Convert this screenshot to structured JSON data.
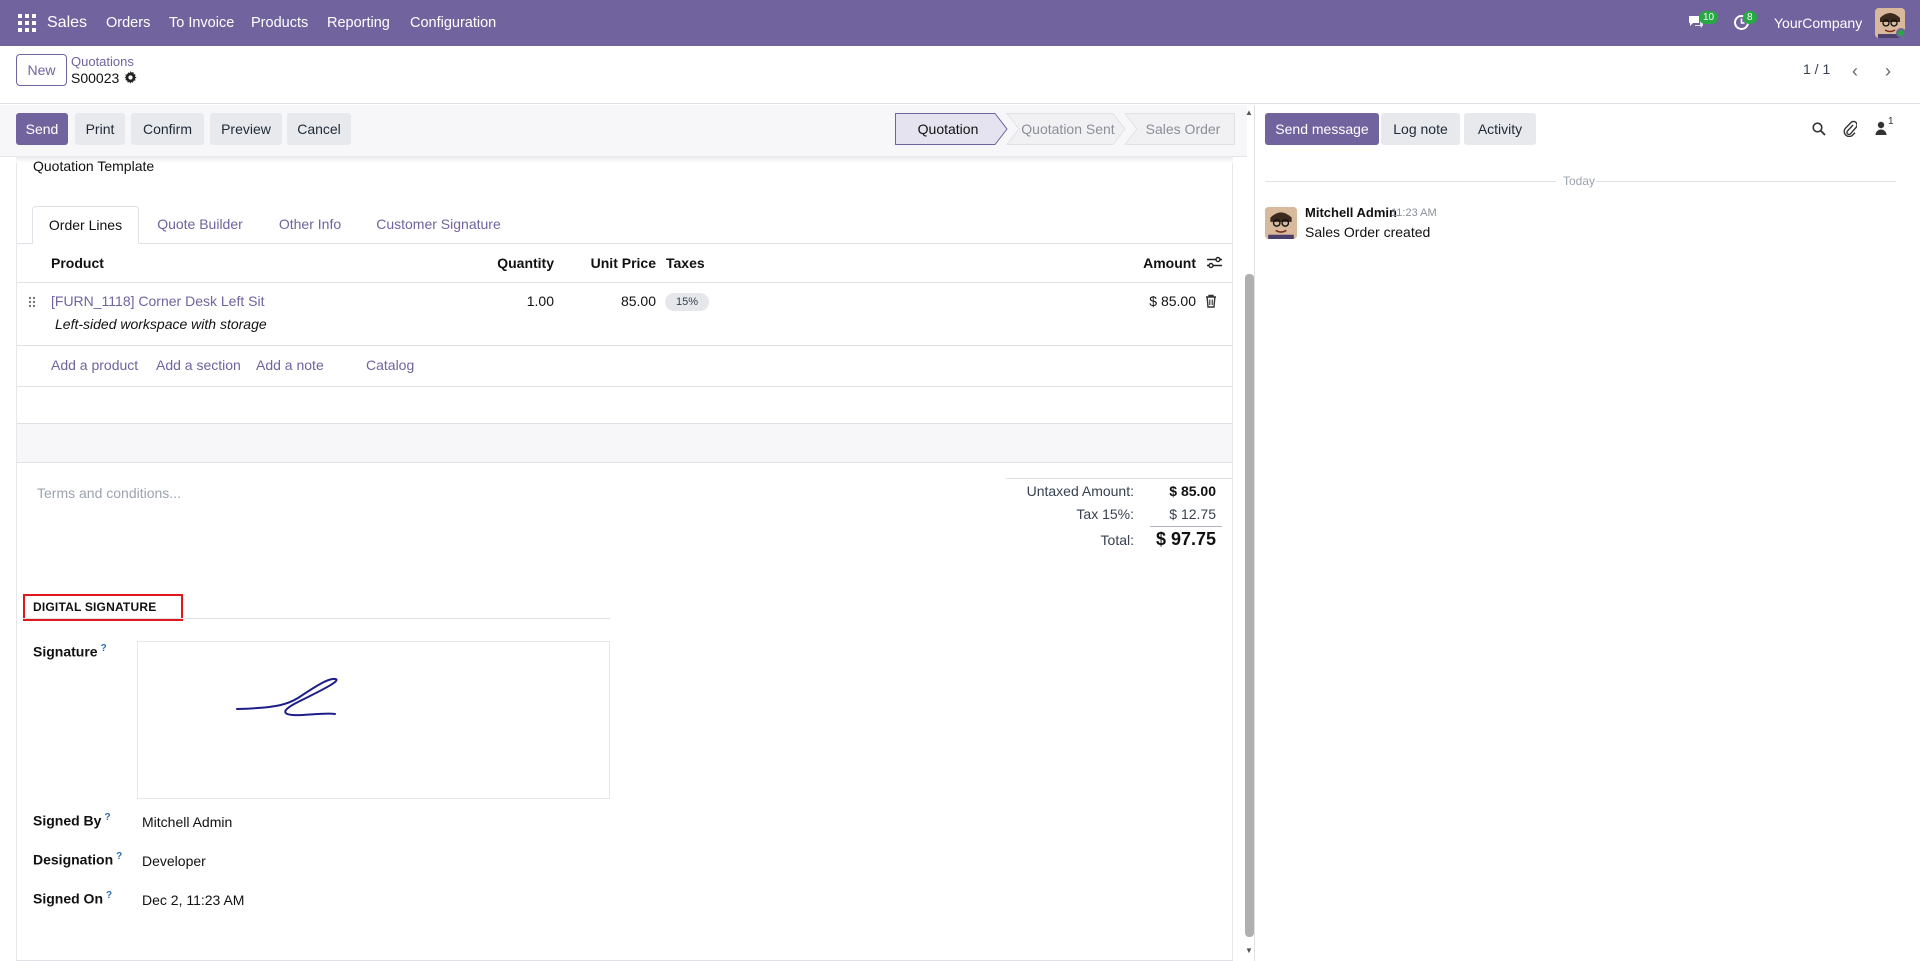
{
  "navbar": {
    "app_name": "Sales",
    "menu": [
      "Orders",
      "To Invoice",
      "Products",
      "Reporting",
      "Configuration"
    ],
    "messages_count": "10",
    "activities_count": "8",
    "company": "YourCompany"
  },
  "control": {
    "new_label": "New",
    "breadcrumb": "Quotations",
    "record_name": "S00023",
    "pager": "1 / 1"
  },
  "actions": {
    "send": "Send",
    "print": "Print",
    "confirm": "Confirm",
    "preview": "Preview",
    "cancel": "Cancel"
  },
  "status": {
    "stages": [
      "Quotation",
      "Quotation Sent",
      "Sales Order"
    ],
    "active": "Quotation"
  },
  "form": {
    "template_label": "Quotation Template",
    "tabs": [
      "Order Lines",
      "Quote Builder",
      "Other Info",
      "Customer Signature"
    ],
    "columns": {
      "product": "Product",
      "quantity": "Quantity",
      "unit_price": "Unit Price",
      "taxes": "Taxes",
      "amount": "Amount"
    },
    "lines": [
      {
        "product": "[FURN_1118] Corner Desk Left Sit",
        "description": "Left-sided workspace with storage",
        "quantity": "1.00",
        "unit_price": "85.00",
        "tax": "15%",
        "amount": "$ 85.00"
      }
    ],
    "add_links": [
      "Add a product",
      "Add a section",
      "Add a note",
      "Catalog"
    ],
    "terms_placeholder": "Terms and conditions...",
    "totals": {
      "untaxed_label": "Untaxed Amount:",
      "untaxed_value": "$ 85.00",
      "tax_label": "Tax 15%:",
      "tax_value": "$ 12.75",
      "total_label": "Total:",
      "total_value": "$ 97.75"
    },
    "digital_signature": {
      "header": "DIGITAL SIGNATURE",
      "signature_label": "Signature",
      "signed_by_label": "Signed By",
      "signed_by_value": "Mitchell Admin",
      "designation_label": "Designation",
      "designation_value": "Developer",
      "signed_on_label": "Signed On",
      "signed_on_value": "Dec 2, 11:23 AM",
      "help_mark": "?"
    }
  },
  "chatter": {
    "send_message": "Send message",
    "log_note": "Log note",
    "activity": "Activity",
    "followers_count": "1",
    "date_separator": "Today",
    "messages": [
      {
        "author": "Mitchell Admin",
        "time": "11:23 AM",
        "body": "Sales Order created"
      }
    ]
  },
  "colors": {
    "brand": "#71639e",
    "badge_green": "#28a745",
    "highlight_red": "#e0171c"
  },
  "icons": [
    "apps-icon",
    "chat-icon",
    "clock-icon",
    "gear-icon",
    "chevron-left-icon",
    "chevron-right-icon",
    "drag-handle-icon",
    "trash-icon",
    "column-settings-icon",
    "search-icon",
    "paperclip-icon",
    "followers-icon"
  ]
}
